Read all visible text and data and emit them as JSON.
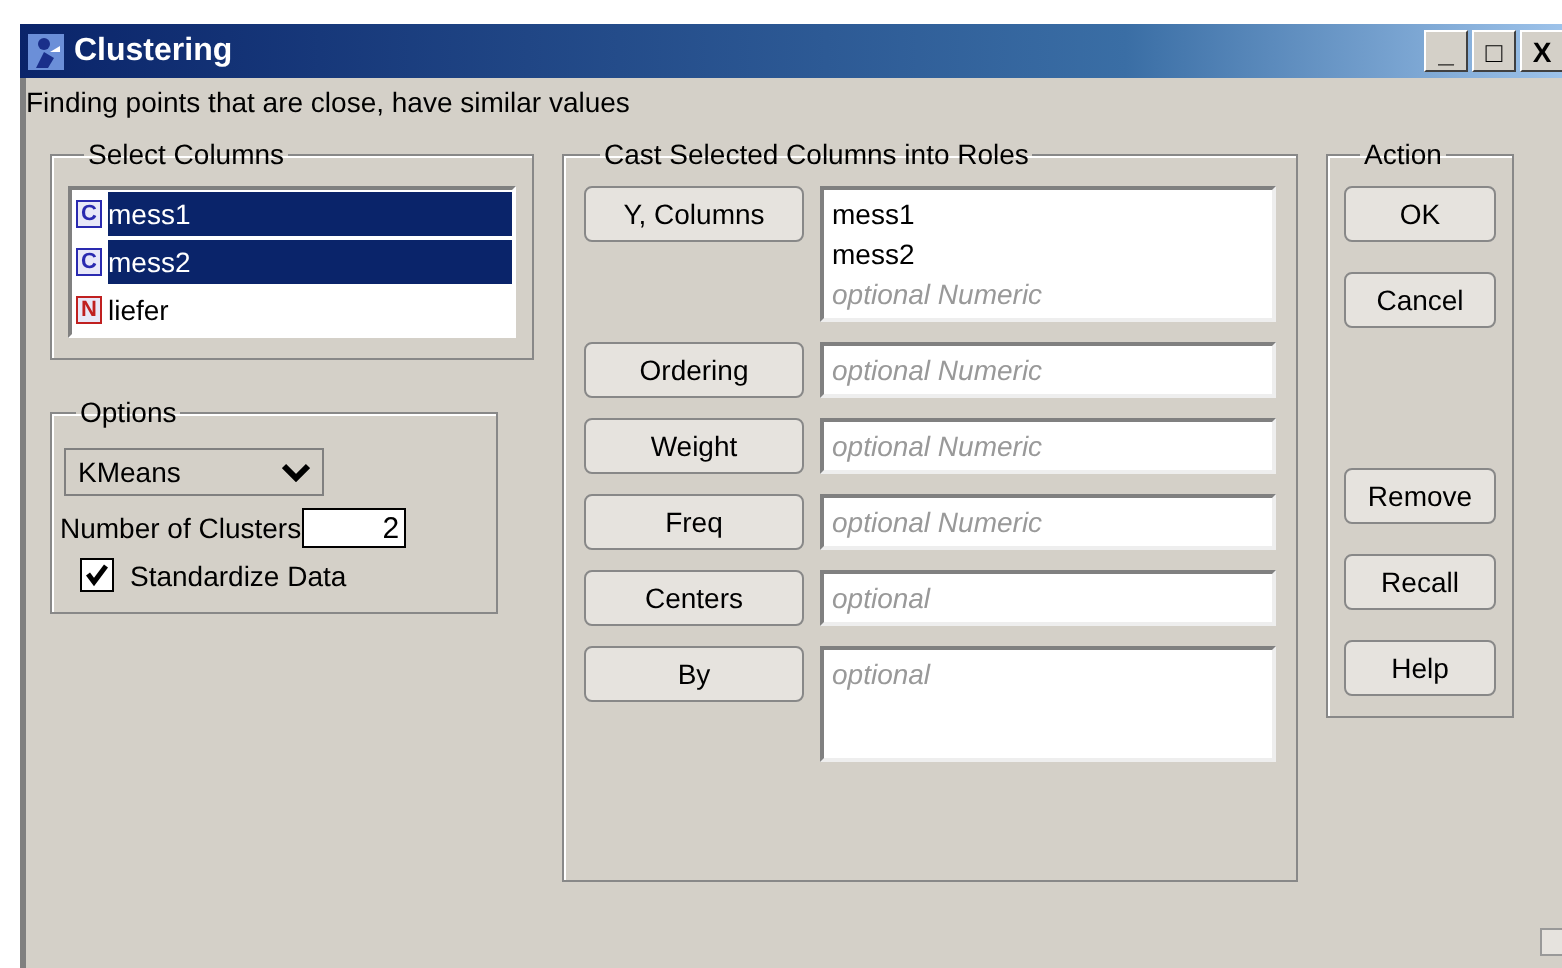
{
  "window": {
    "title": "Clustering",
    "controls": [
      "_",
      "□",
      "X"
    ]
  },
  "description": "Finding points that are close, have similar values",
  "select_columns": {
    "title": "Select Columns",
    "items": [
      {
        "badge": "C",
        "kind": "continuous",
        "name": "mess1",
        "selected": true
      },
      {
        "badge": "C",
        "kind": "continuous",
        "name": "mess2",
        "selected": true
      },
      {
        "badge": "N",
        "kind": "nominal",
        "name": "liefer",
        "selected": false
      }
    ]
  },
  "options": {
    "title": "Options",
    "method": "KMeans",
    "clusters_label": "Number of Clusters",
    "clusters": "2",
    "standardize": {
      "label": "Standardize Data",
      "checked": true
    }
  },
  "roles": {
    "title": "Cast Selected Columns into Roles",
    "items": [
      {
        "label": "Y, Columns",
        "kind": "list",
        "values": [
          "mess1",
          "mess2"
        ],
        "placeholder": "optional Numeric"
      },
      {
        "label": "Ordering",
        "kind": "single",
        "placeholder": "optional Numeric"
      },
      {
        "label": "Weight",
        "kind": "single",
        "placeholder": "optional Numeric"
      },
      {
        "label": "Freq",
        "kind": "single",
        "placeholder": "optional Numeric"
      },
      {
        "label": "Centers",
        "kind": "single",
        "placeholder": "optional"
      },
      {
        "label": "By",
        "kind": "list",
        "placeholder": "optional"
      }
    ]
  },
  "action": {
    "title": "Action",
    "buttons": [
      "OK",
      "Cancel"
    ],
    "more_buttons": [
      "Remove",
      "Recall",
      "Help"
    ]
  }
}
